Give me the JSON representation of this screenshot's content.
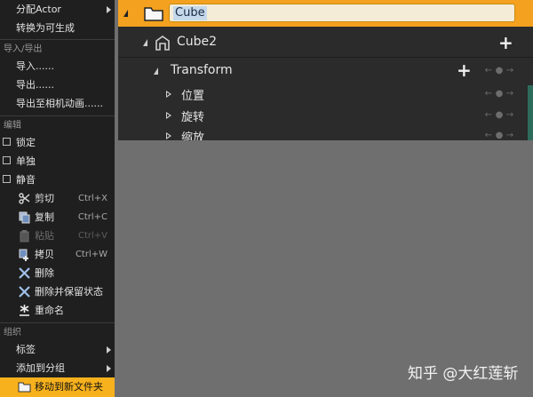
{
  "menu": {
    "top_items": [
      {
        "label": "分配Actor",
        "submenu": true
      },
      {
        "label": "转换为可生成",
        "submenu": false
      }
    ],
    "sections": {
      "import_export": "导入/导出",
      "edit": "编辑",
      "group": "组织"
    },
    "import_export_items": [
      {
        "label": "导入......"
      },
      {
        "label": "导出......"
      },
      {
        "label": "导出至相机动画......"
      }
    ],
    "toggles": [
      {
        "label": "锁定",
        "checked": false
      },
      {
        "label": "单独",
        "checked": false
      },
      {
        "label": "静音",
        "checked": false
      }
    ],
    "edit_items": [
      {
        "label": "剪切",
        "shortcut": "Ctrl+X",
        "icon": "scissors-icon",
        "enabled": true
      },
      {
        "label": "复制",
        "shortcut": "Ctrl+C",
        "icon": "copy-icon",
        "enabled": true
      },
      {
        "label": "粘贴",
        "shortcut": "Ctrl+V",
        "icon": "paste-icon",
        "enabled": false
      },
      {
        "label": "拷贝",
        "shortcut": "Ctrl+W",
        "icon": "duplicate-icon",
        "enabled": true
      },
      {
        "label": "删除",
        "shortcut": "",
        "icon": "delete-x-icon",
        "enabled": true
      },
      {
        "label": "删除并保留状态",
        "shortcut": "",
        "icon": "delete-x-icon",
        "enabled": true
      },
      {
        "label": "重命名",
        "shortcut": "",
        "icon": "rename-star-icon",
        "enabled": true
      }
    ],
    "group_items": [
      {
        "label": "标签",
        "submenu": true
      },
      {
        "label": "添加到分组",
        "submenu": true
      },
      {
        "label": "移动到新文件夹",
        "submenu": false,
        "highlighted": true,
        "icon": "folder-icon"
      }
    ]
  },
  "panel": {
    "actor_name": "Cube",
    "component_name": "Cube2",
    "transform_label": "Transform",
    "properties": [
      {
        "label": "位置"
      },
      {
        "label": "旋转"
      },
      {
        "label": "缩放"
      }
    ],
    "nav_glyphs": {
      "left": "←",
      "dot": "●",
      "right": "→"
    },
    "colors": {
      "header_orange": "#f3a11f",
      "menu_highlight": "#f7b11d",
      "panel_bg": "#2b2b2b",
      "menu_bg": "#1f1f1f"
    }
  },
  "watermark": "知乎 @大红莲斩"
}
